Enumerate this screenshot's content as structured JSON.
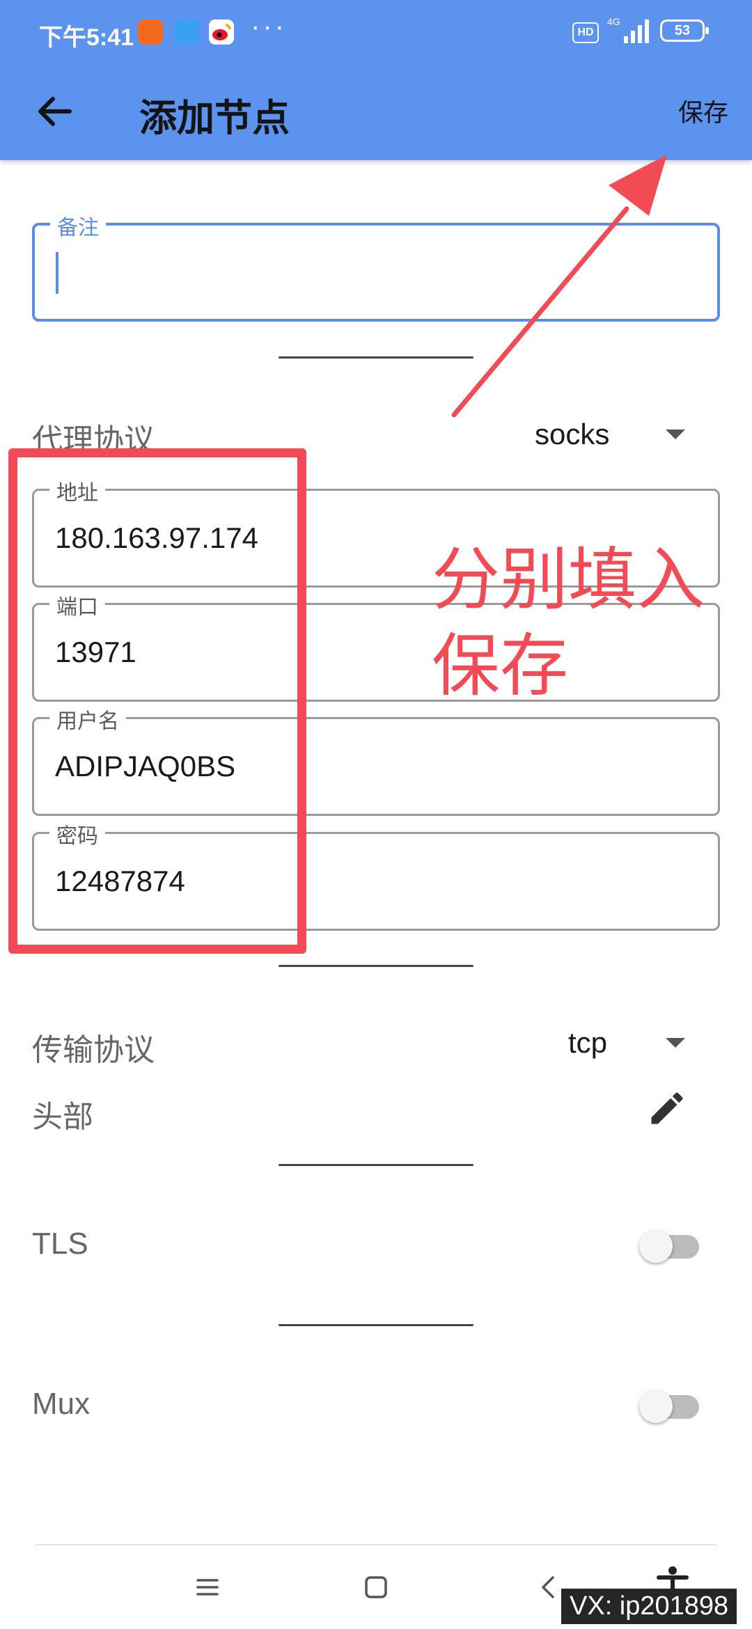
{
  "status_bar": {
    "time": "下午5:41",
    "more": "···",
    "hd": "HD",
    "network": "4G",
    "battery": "53"
  },
  "app_bar": {
    "back_icon": "arrow-back-icon",
    "title": "添加节点",
    "save_label": "保存"
  },
  "remark": {
    "label": "备注",
    "value": ""
  },
  "proxy_protocol": {
    "label": "代理协议",
    "value": "socks"
  },
  "server_fields": [
    {
      "label": "地址",
      "value": "180.163.97.174"
    },
    {
      "label": "端口",
      "value": "13971"
    },
    {
      "label": "用户名",
      "value": "ADIPJAQ0BS"
    },
    {
      "label": "密码",
      "value": "12487874"
    }
  ],
  "transport": {
    "label": "传输协议",
    "value": "tcp"
  },
  "header": {
    "label": "头部",
    "icon": "edit-pencil-icon"
  },
  "tls": {
    "label": "TLS",
    "enabled": false
  },
  "mux": {
    "label": "Mux",
    "enabled": false
  },
  "annotation": {
    "line1": "分别填入",
    "line2": "保存"
  },
  "watermark": "VX: ip201898",
  "colors": {
    "accent": "#5b93ef",
    "annotation": "#f24b55"
  }
}
